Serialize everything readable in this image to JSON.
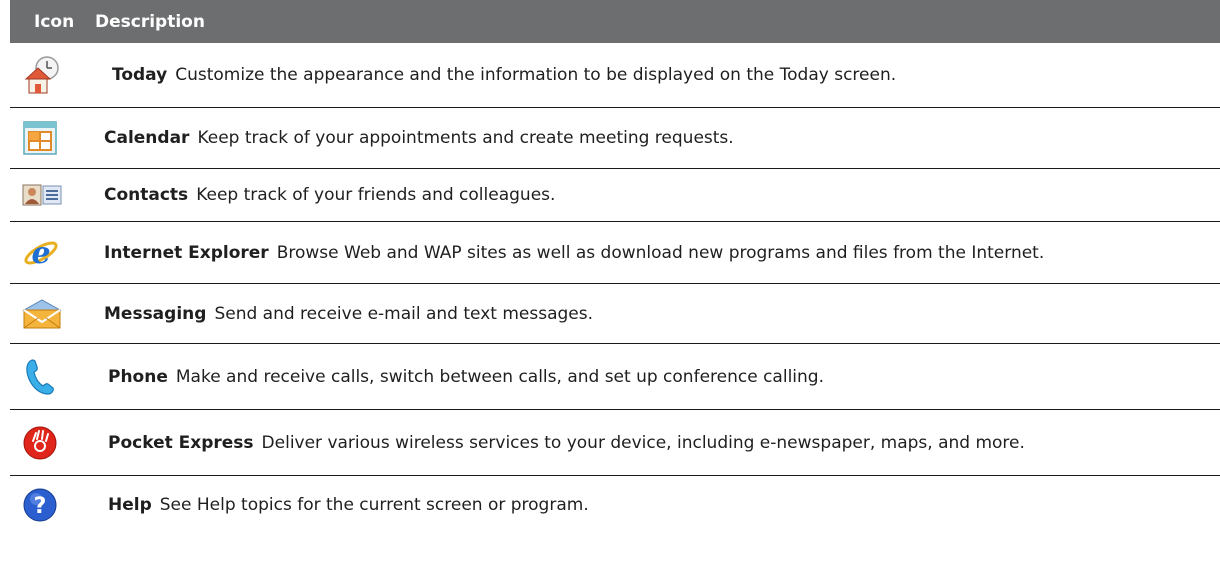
{
  "header": {
    "icon": "Icon",
    "description": "Description"
  },
  "rows": [
    {
      "icon": "today-icon",
      "name": "Today",
      "text": "Customize the appearance and the information to be displayed on the Today screen."
    },
    {
      "icon": "calendar-icon",
      "name": "Calendar",
      "text": "Keep track of your appointments and create meeting requests."
    },
    {
      "icon": "contacts-icon",
      "name": "Contacts",
      "text": "Keep track of your friends and colleagues."
    },
    {
      "icon": "internet-explorer-icon",
      "name": "Internet Explorer",
      "text": "Browse Web and WAP sites as well as download new programs and files from the Internet."
    },
    {
      "icon": "messaging-icon",
      "name": "Messaging",
      "text": "Send and receive e-mail and text messages."
    },
    {
      "icon": "phone-icon",
      "name": "Phone",
      "text": "Make and receive calls, switch between calls, and set up conference calling."
    },
    {
      "icon": "pocket-express-icon",
      "name": "Pocket Express",
      "text": "Deliver various wireless services to your device, including e-newspaper, maps, and more."
    },
    {
      "icon": "help-icon",
      "name": "Help",
      "text": "See Help topics for the current screen or program."
    }
  ]
}
